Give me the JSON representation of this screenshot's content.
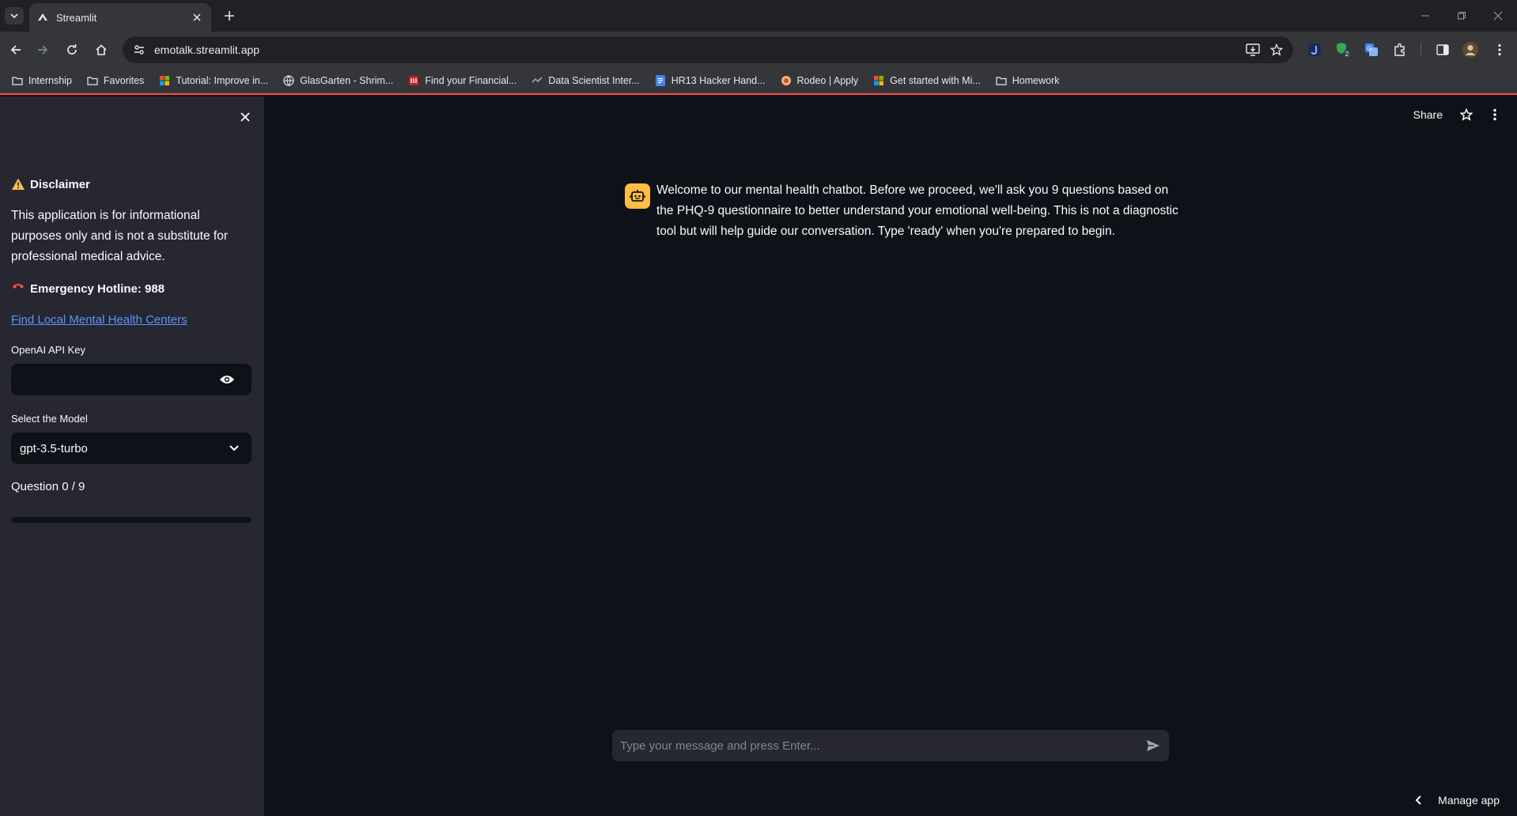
{
  "browser": {
    "tab_title": "Streamlit",
    "url": "emotalk.streamlit.app",
    "extension_badge": "2",
    "bookmarks": [
      {
        "label": "Internship",
        "icon": "folder-icon"
      },
      {
        "label": "Favorites",
        "icon": "folder-icon"
      },
      {
        "label": "Tutorial: Improve in...",
        "icon": "microsoft-icon"
      },
      {
        "label": "GlasGarten - Shrim...",
        "icon": "globe-icon"
      },
      {
        "label": "Find your Financial...",
        "icon": "bank-icon"
      },
      {
        "label": "Data Scientist Inter...",
        "icon": "company-icon"
      },
      {
        "label": "HR13 Hacker Hand...",
        "icon": "docs-icon"
      },
      {
        "label": "Rodeo | Apply",
        "icon": "rodeo-icon"
      },
      {
        "label": "Get started with Mi...",
        "icon": "microsoft-icon"
      },
      {
        "label": "Homework",
        "icon": "folder-icon"
      }
    ]
  },
  "header": {
    "share_label": "Share"
  },
  "sidebar": {
    "disclaimer_title": "Disclaimer",
    "disclaimer_text": "This application is for informational purposes only and is not a substitute for professional medical advice.",
    "hotline": "Emergency Hotline: 988",
    "find_link": "Find Local Mental Health Centers",
    "api_key_label": "OpenAI API Key",
    "api_key_value": "",
    "model_label": "Select the Model",
    "model_value": "gpt-3.5-turbo",
    "progress_label": "Question 0 / 9",
    "progress_fraction": 0
  },
  "chat": {
    "messages": [
      {
        "role": "assistant",
        "text": "Welcome to our mental health chatbot. Before we proceed, we'll ask you 9 questions based on the PHQ-9 questionnaire to better understand your emotional well-being. This is not a diagnostic tool but will help guide our conversation. Type 'ready' when you're prepared to begin."
      }
    ],
    "input_placeholder": "Type your message and press Enter..."
  },
  "footer": {
    "manage_app": "Manage app"
  },
  "colors": {
    "app_bg": "#0e1117",
    "sidebar_bg": "#262730",
    "accent": "#ff4b4b",
    "link": "#5c94ff",
    "avatar_bg": "#ffbd45"
  }
}
